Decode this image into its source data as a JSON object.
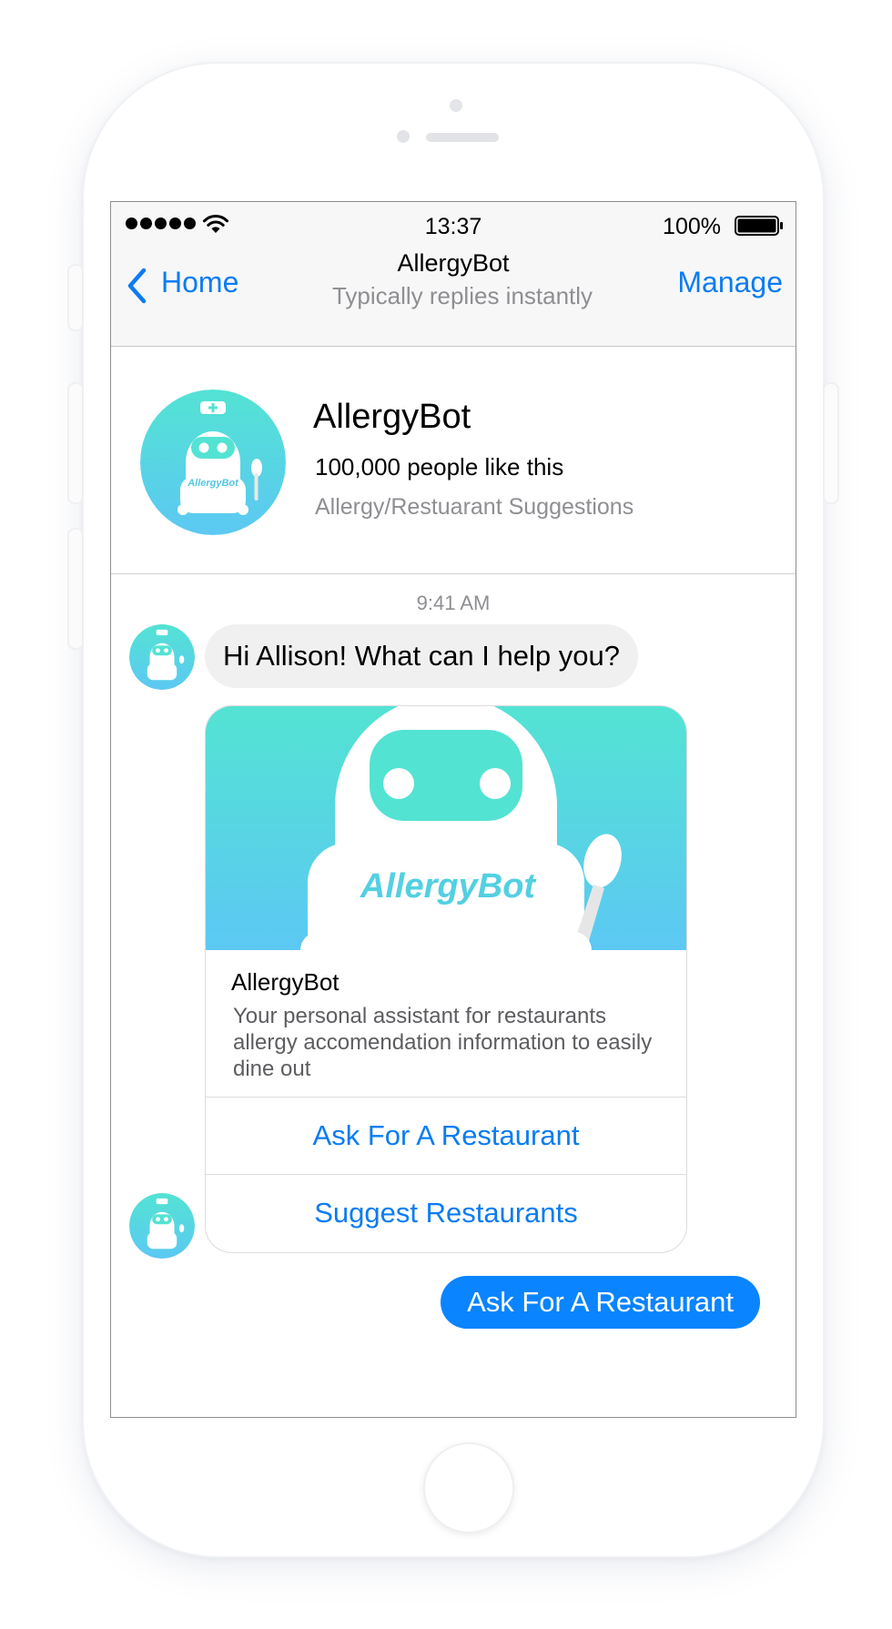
{
  "status_bar": {
    "time": "13:37",
    "battery_percent": "100%",
    "signal_bars": 5,
    "icons": [
      "signal-dots-icon",
      "wifi-icon",
      "battery-icon"
    ]
  },
  "nav": {
    "back_label": "Home",
    "title": "AllergyBot",
    "subtitle": "Typically replies instantly",
    "manage_label": "Manage",
    "accent_color": "#0a7cf2"
  },
  "profile": {
    "name": "AllergyBot",
    "likes": "100,000 people like this",
    "category": "Allergy/Restuarant Suggestions",
    "avatar_text": "AllergyBot"
  },
  "conversation": {
    "timestamp": "9:41 AM",
    "incoming_message": "Hi Allison! What can I help you?",
    "card": {
      "image_text": "AllergyBot",
      "title": "AllergyBot",
      "description": "Your personal assistant for restaurants allergy accomendation information to easily dine out",
      "buttons": [
        "Ask For A Restaurant",
        "Suggest Restaurants"
      ]
    },
    "outgoing_message": "Ask For A Restaurant"
  },
  "colors": {
    "brand_gradient_top": "#53e3d3",
    "brand_gradient_bottom": "#5cc8f3",
    "outgoing_bubble": "#0a84ff",
    "incoming_bubble": "#f1f0f0"
  }
}
